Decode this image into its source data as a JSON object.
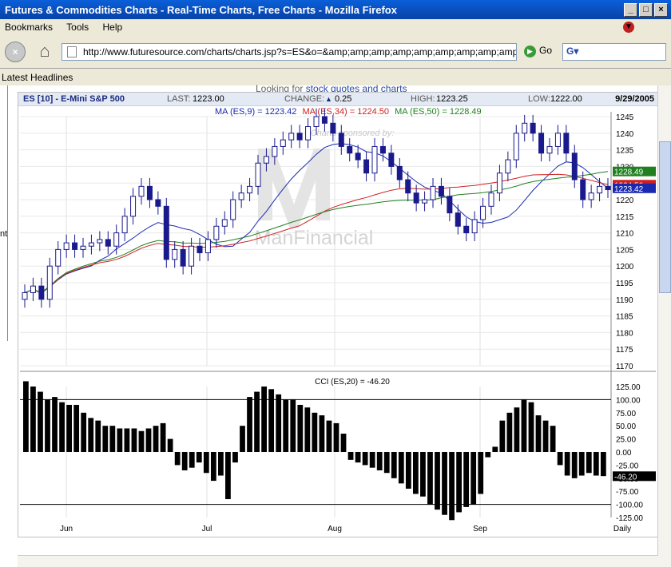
{
  "window": {
    "title": "Futures & Commodities Charts - Real-Time Charts, Free Charts - Mozilla Firefox"
  },
  "menu": [
    "Bookmarks",
    "Tools",
    "Help"
  ],
  "nav": {
    "url": "http://www.futuresource.com/charts/charts.jsp?s=ES&o=&amp;amp;amp;amp;amp;amp;amp;amp;amp;a=D",
    "go_label": "Go"
  },
  "toolbar": {
    "headlines": "Latest Headlines"
  },
  "page": {
    "teaser_prefix": "Looking for ",
    "teaser_link": "stock quotes and charts",
    "left_frame_text": "nt"
  },
  "chart_header": {
    "symbol": "ES [10] - E-Mini S&P 500",
    "last_label": "LAST:",
    "last_value": "1223.00",
    "change_label": "CHANGE:",
    "change_value": "0.25",
    "high_label": "HIGH:",
    "high_value": "1223.25",
    "low_label": "LOW:",
    "low_value": "1222.00",
    "date": "9/29/2005"
  },
  "ma_legend": [
    {
      "text": "MA (ES,9) = 1223.42",
      "color": "#1a2ab0"
    },
    {
      "text": "MA (ES,34) = 1224.50",
      "color": "#d02020"
    },
    {
      "text": "MA (ES,50) = 1228.49",
      "color": "#208020"
    }
  ],
  "watermark": {
    "sponsor": "Charts sponsored by:",
    "brand": "ManFinancial"
  },
  "cci_label": "CCI (ES,20) = -46.20",
  "colors": {
    "candle": "#1a1a8c",
    "ma9": "#1a2ab0",
    "ma34": "#d02020",
    "ma50": "#208020",
    "cci": "#000000"
  },
  "chart_data": [
    {
      "type": "candlestick",
      "title": "ES [10] - E-Mini S&P 500",
      "x": [
        "Jun",
        "Jul",
        "Aug",
        "Sep"
      ],
      "period": "Daily",
      "ylim": [
        1170,
        1245
      ],
      "yticks": [
        1245,
        1240,
        1235,
        1230,
        1225,
        1220,
        1215,
        1210,
        1205,
        1200,
        1195,
        1190,
        1185,
        1180,
        1175,
        1170
      ],
      "closes": [
        1192,
        1194,
        1190,
        1200,
        1205,
        1207,
        1205,
        1206,
        1207,
        1208,
        1206,
        1210,
        1215,
        1221,
        1224,
        1220,
        1218,
        1202,
        1205,
        1200,
        1206,
        1204,
        1208,
        1212,
        1214,
        1220,
        1222,
        1224,
        1231,
        1233,
        1236,
        1238,
        1240,
        1238,
        1242,
        1245,
        1243,
        1240,
        1236,
        1234,
        1232,
        1228,
        1236,
        1234,
        1230,
        1226,
        1222,
        1219,
        1220,
        1224,
        1221,
        1216,
        1212,
        1210,
        1214,
        1218,
        1222,
        1228,
        1232,
        1240,
        1243,
        1240,
        1234,
        1236,
        1240,
        1234,
        1226,
        1220,
        1222,
        1224,
        1223
      ],
      "series": [
        {
          "name": "MA (ES,9)",
          "last": 1223.42
        },
        {
          "name": "MA (ES,34)",
          "last": 1224.5
        },
        {
          "name": "MA (ES,50)",
          "last": 1228.49
        }
      ],
      "price_tags": [
        "1228.49",
        "1224.50",
        "1223.42"
      ]
    },
    {
      "type": "bar",
      "title": "CCI (ES,20) = -46.20",
      "ylim": [
        -125,
        125
      ],
      "yticks": [
        125,
        100,
        75,
        50,
        25,
        0,
        -25,
        -50,
        -75,
        -100,
        -125
      ],
      "reference_lines": [
        100,
        -100
      ],
      "last_tag": "-46.20",
      "values": [
        135,
        125,
        115,
        100,
        105,
        95,
        90,
        90,
        75,
        65,
        60,
        50,
        50,
        45,
        45,
        45,
        40,
        45,
        50,
        55,
        25,
        -25,
        -35,
        -30,
        -20,
        -40,
        -55,
        -45,
        -90,
        -20,
        50,
        105,
        115,
        125,
        120,
        110,
        100,
        100,
        90,
        85,
        75,
        70,
        60,
        55,
        35,
        -15,
        -20,
        -25,
        -30,
        -35,
        -40,
        -50,
        -60,
        -70,
        -80,
        -85,
        -100,
        -110,
        -120,
        -130,
        -115,
        -105,
        -100,
        -80,
        -10,
        10,
        60,
        75,
        85,
        100,
        95,
        70,
        60,
        50,
        -25,
        -45,
        -50,
        -45,
        -40,
        -45,
        -46
      ]
    },
    {
      "type": "x-axis",
      "labels": [
        "Jun",
        "Jul",
        "Aug",
        "Sep",
        "Daily"
      ]
    }
  ]
}
